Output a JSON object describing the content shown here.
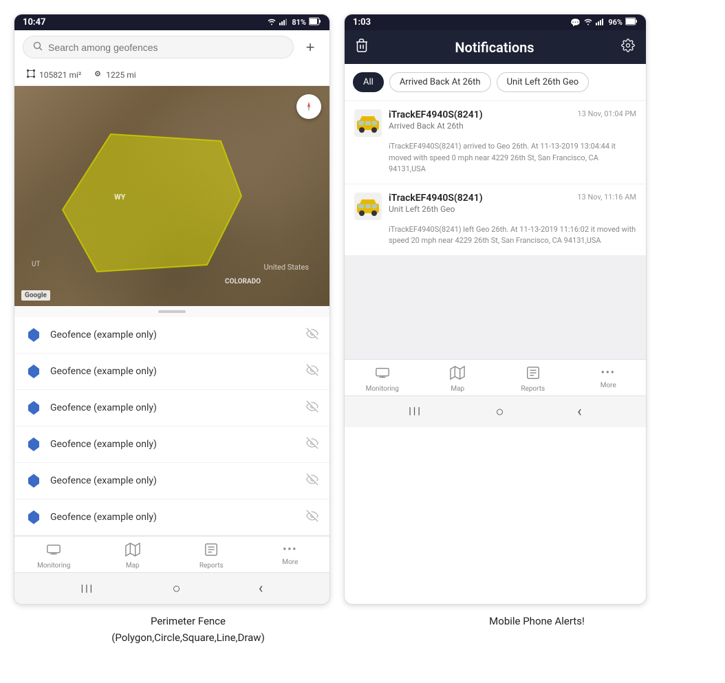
{
  "left_phone": {
    "status_bar": {
      "time": "10:47",
      "wifi": "WiFi",
      "signal": "Signal",
      "battery": "81%"
    },
    "search": {
      "placeholder": "Search among geofences"
    },
    "stats": {
      "area": "105821 mi²",
      "distance": "1225 mi"
    },
    "geofence_items": [
      {
        "label": "Geofence (example only)"
      },
      {
        "label": "Geofence (example only)"
      },
      {
        "label": "Geofence (example only)"
      },
      {
        "label": "Geofence (example only)"
      },
      {
        "label": "Geofence (example only)"
      },
      {
        "label": "Geofence (example only)"
      }
    ],
    "map_labels": {
      "wy": "WY",
      "us": "United States",
      "co": "COLORADO",
      "ut": "UT",
      "google": "Google"
    },
    "nav_items": [
      {
        "icon": "🚌",
        "label": "Monitoring"
      },
      {
        "icon": "🗺",
        "label": "Map"
      },
      {
        "icon": "📊",
        "label": "Reports"
      },
      {
        "icon": "•••",
        "label": "More"
      }
    ],
    "android_nav": {
      "menu": "|||",
      "home": "○",
      "back": "‹"
    }
  },
  "right_phone": {
    "status_bar": {
      "time": "1:03",
      "chat_icon": "💬",
      "wifi": "WiFi",
      "signal": "Signal",
      "battery": "96%"
    },
    "header": {
      "title": "Notifications",
      "delete_label": "Delete",
      "settings_label": "Settings"
    },
    "filter_chips": [
      {
        "label": "All",
        "active": true
      },
      {
        "label": "Arrived Back At 26th",
        "active": false
      },
      {
        "label": "Unit Left 26th Geo",
        "active": false
      }
    ],
    "notifications": [
      {
        "device": "iTrackEF4940S(8241)",
        "timestamp": "13 Nov, 01:04 PM",
        "event": "Arrived Back At 26th",
        "description": "iTrackEF4940S(8241) arrived to Geo 26th.    At 11-13-2019 13:04:44 it moved with speed 0 mph near 4229 26th St, San Francisco, CA 94131,USA"
      },
      {
        "device": "iTrackEF4940S(8241)",
        "timestamp": "13 Nov, 11:16 AM",
        "event": "Unit Left 26th Geo",
        "description": "iTrackEF4940S(8241) left Geo 26th.    At 11-13-2019 11:16:02 it moved with speed 20 mph near 4229 26th St, San Francisco, CA 94131,USA"
      }
    ],
    "nav_items": [
      {
        "icon": "🚌",
        "label": "Monitoring"
      },
      {
        "icon": "🗺",
        "label": "Map"
      },
      {
        "icon": "📊",
        "label": "Reports"
      },
      {
        "icon": "•••",
        "label": "More"
      }
    ],
    "android_nav": {
      "menu": "|||",
      "home": "○",
      "back": "‹"
    }
  },
  "captions": {
    "left": "Perimeter Fence\n(Polygon,Circle,Square,Line,Draw)",
    "right": "Mobile Phone Alerts!"
  }
}
